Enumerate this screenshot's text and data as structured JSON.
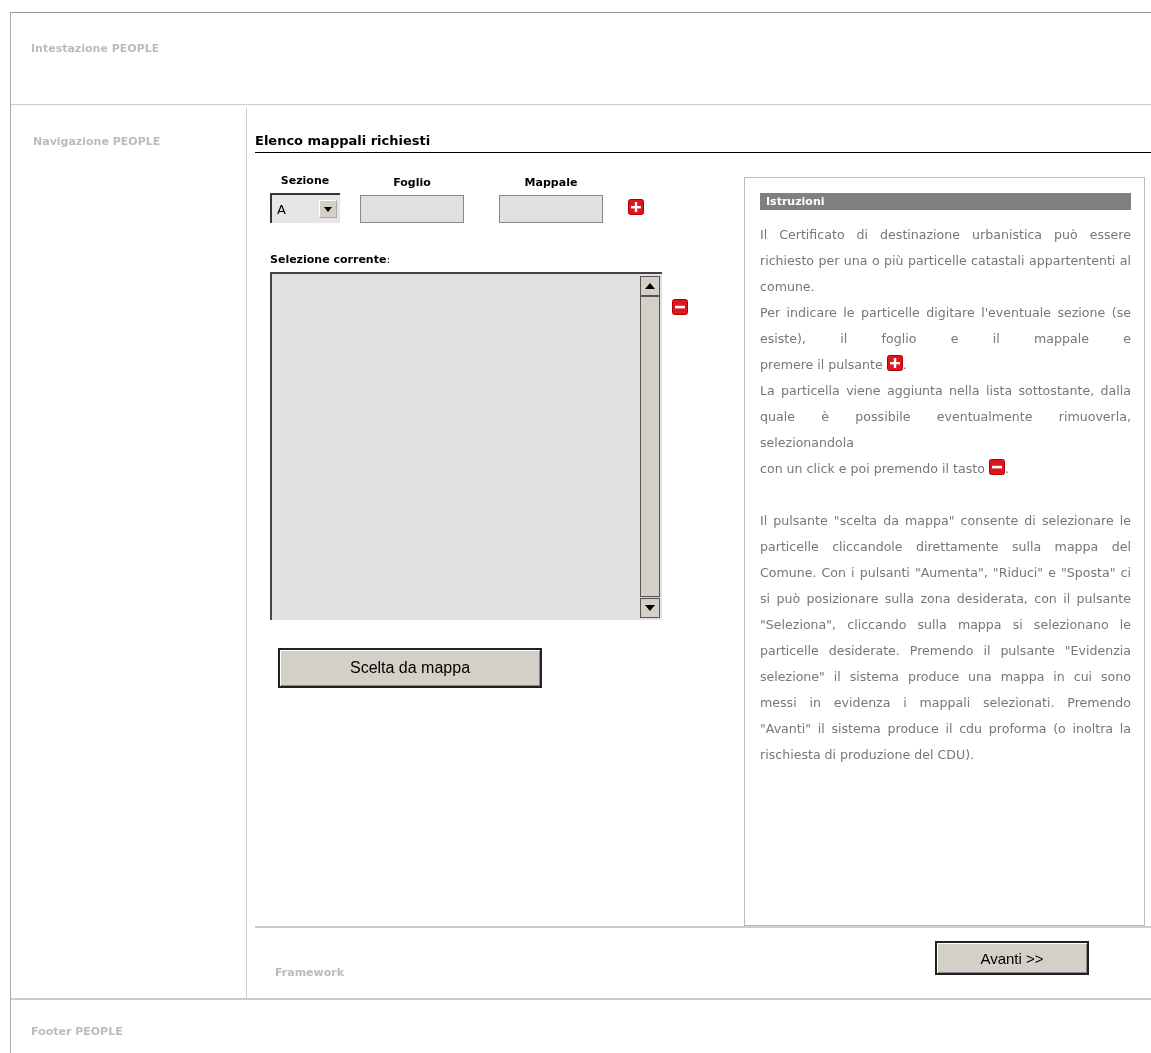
{
  "header": {
    "title": "Intestazione PEOPLE"
  },
  "navigation": {
    "title": "Navigazione PEOPLE"
  },
  "main": {
    "title": "Elenco mappali richiesti",
    "fields": [
      {
        "label": "Sezione",
        "kind": "dropdown",
        "value": "A"
      },
      {
        "label": "Foglio",
        "kind": "text"
      },
      {
        "label": "Mappale",
        "kind": "text"
      }
    ],
    "selection_label": "Selezione corrente",
    "selection_colon": ":",
    "map_button": "Scelta da mappa",
    "instructions": {
      "title": "Istruzioni",
      "paragraphs": [
        [
          {
            "kind": "text",
            "text": "Il Certificato di destinazione urbanistica può essere richiesto per una o più particelle catastali appartententi al comune."
          }
        ],
        [
          {
            "kind": "block",
            "text": "Per indicare le particelle digitare l'eventuale sezione (se esiste), il foglio e il mappale e"
          },
          {
            "kind": "text",
            "text": "premere il pulsante"
          },
          {
            "kind": "add-icon"
          },
          {
            "kind": "text",
            "text": "."
          }
        ],
        [
          {
            "kind": "block",
            "text": "La particella viene aggiunta nella lista sottostante, dalla quale è possibile eventualmente rimuoverla, selezionandola"
          },
          {
            "kind": "text",
            "text": "con un click e poi premendo il tasto"
          },
          {
            "kind": "remove-icon"
          },
          {
            "kind": "text",
            "text": "."
          }
        ],
        [
          {
            "kind": "gap"
          }
        ],
        [
          {
            "kind": "text",
            "text": "Il pulsante \"scelta da mappa\" consente di selezionare le particelle cliccandole direttamente sulla mappa del Comune. Con i pulsanti \"Aumenta\", \"Riduci\" e \"Sposta\" ci si può posizionare sulla zona desiderata, con il pulsante \"Seleziona\", cliccando sulla mappa si selezionano le particelle desiderate. Premendo il pulsante \"Evidenzia selezione\" il sistema produce una mappa in cui sono messi in evidenza i mappali selezionati. Premendo \"Avanti\" il sistema produce il cdu proforma (o inoltra la rischiesta di produzione del CDU)."
          }
        ]
      ]
    }
  },
  "framework": {
    "title": "Framework",
    "next_button": "Avanti >>"
  },
  "footer": {
    "title": "Footer PEOPLE"
  }
}
